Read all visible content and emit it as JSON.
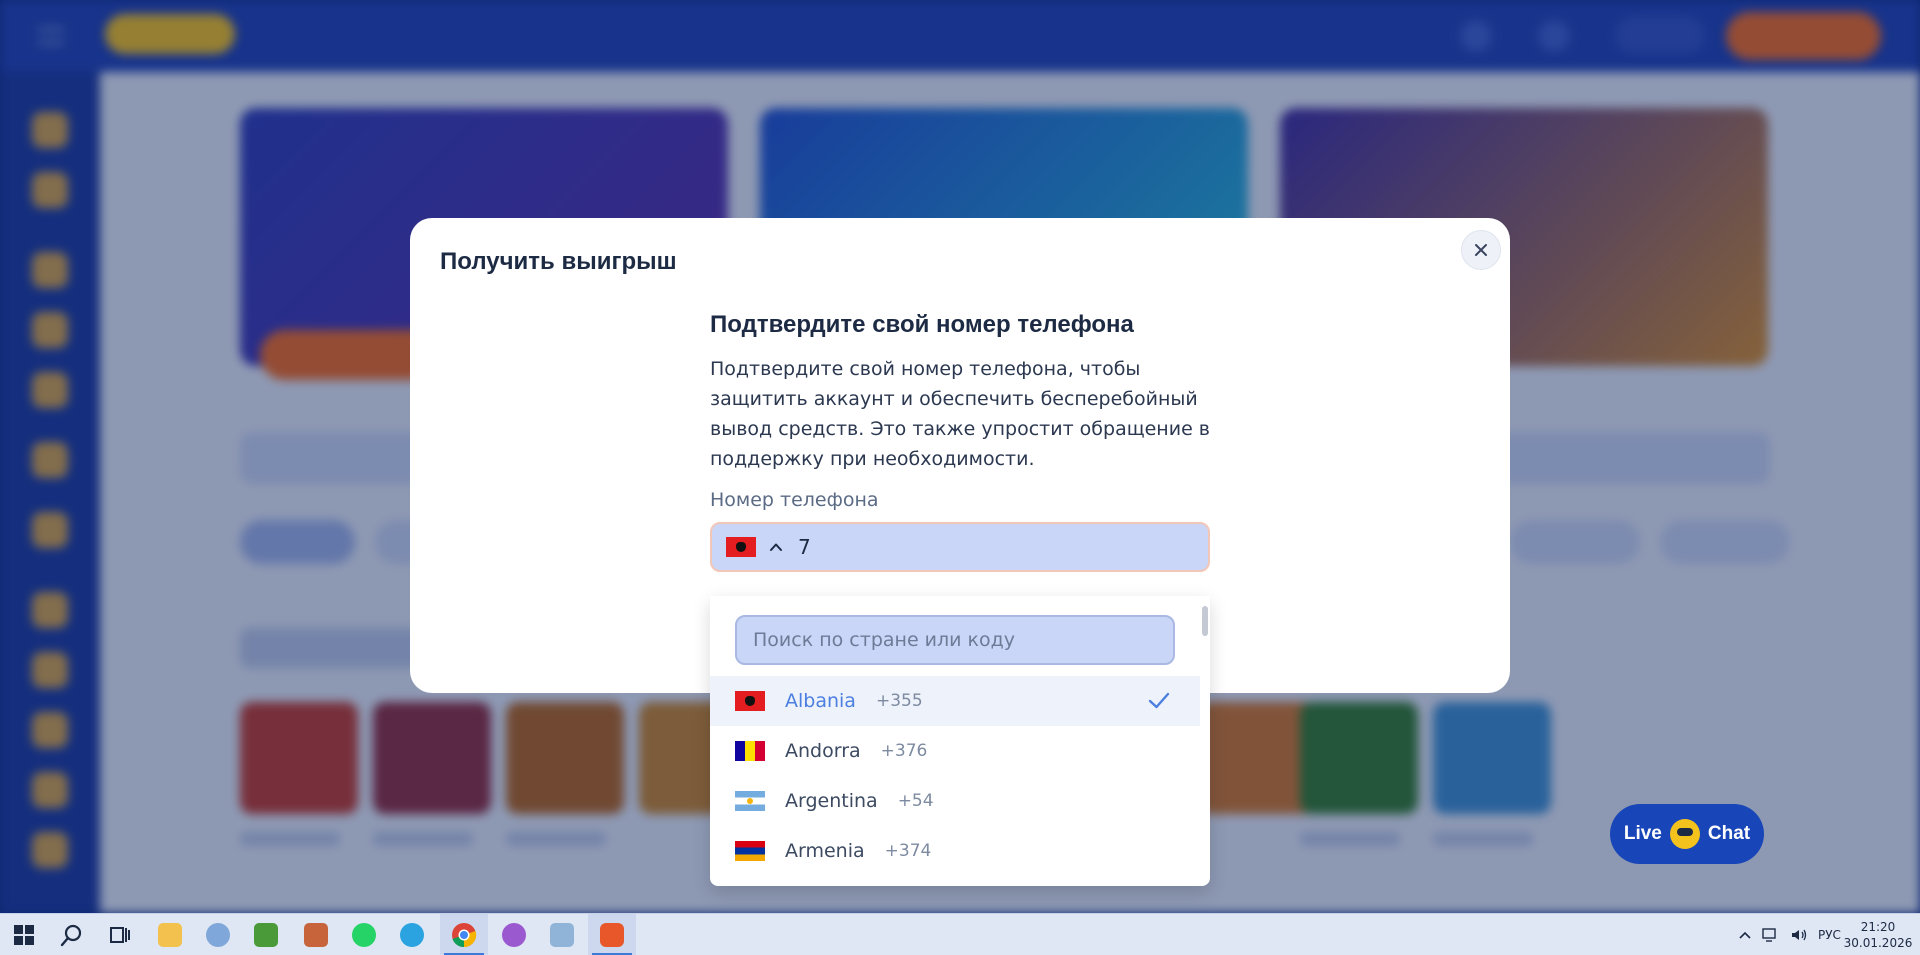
{
  "modal": {
    "title": "Получить выигрыш",
    "heading": "Подтвердите свой номер телефона",
    "description": "Подтвердите свой номер телефона, чтобы защитить аккаунт и обеспечить бесперебойный вывод средств. Это также упростит обращение в поддержку при необходимости.",
    "phone_label": "Номер телефона",
    "phone_value": "7",
    "selected_flag": "albania-flag"
  },
  "dropdown": {
    "search_placeholder": "Поиск по стране или коду",
    "countries": [
      {
        "name": "Albania",
        "code": "+355",
        "flag": "al",
        "selected": true
      },
      {
        "name": "Andorra",
        "code": "+376",
        "flag": "ad",
        "selected": false
      },
      {
        "name": "Argentina",
        "code": "+54",
        "flag": "ar",
        "selected": false
      },
      {
        "name": "Armenia",
        "code": "+374",
        "flag": "am",
        "selected": false
      }
    ]
  },
  "live_chat": {
    "left": "Live",
    "right": "Chat"
  },
  "taskbar": {
    "apps": [
      "start-icon",
      "search-icon",
      "task-view-icon",
      "file-explorer-icon",
      "paint-icon",
      "notepad-icon",
      "photo-app-icon",
      "whatsapp-icon",
      "telegram-icon",
      "chrome-icon",
      "purple-app-icon",
      "book-app-icon",
      "brave-icon"
    ],
    "active_app": "chrome-icon",
    "language": "РУС",
    "time": "21:20",
    "date": "30.01.2026"
  },
  "colors": {
    "accent": "#4b7fe0",
    "modal_bg": "#ffffff",
    "input_bg": "#c9d6f7",
    "chat_bg": "#1846b8",
    "deposit_orange": "#f26a21"
  }
}
